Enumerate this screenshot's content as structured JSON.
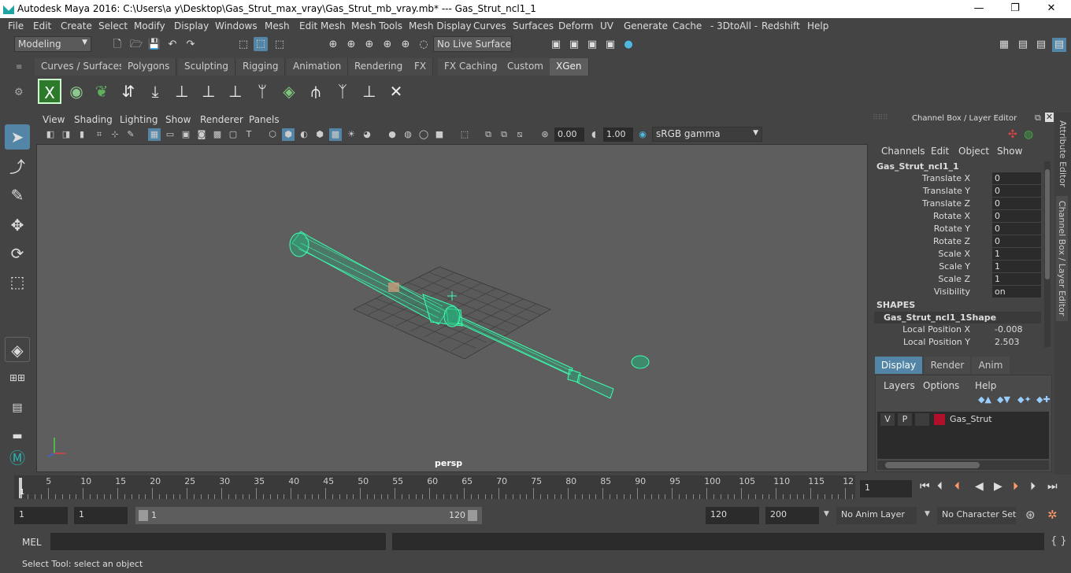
{
  "window": {
    "title": "Autodesk Maya 2016: C:\\Users\\a y\\Desktop\\Gas_Strut_max_vray\\Gas_Strut_mb_vray.mb*   ---   Gas_Strut_ncl1_1",
    "minimize": "—",
    "maximize": "❐",
    "close": "✕"
  },
  "menubar": [
    "File",
    "Edit",
    "Create",
    "Select",
    "Modify",
    "Display",
    "Windows",
    "Mesh",
    "Edit Mesh",
    "Mesh Tools",
    "Mesh Display",
    "Curves",
    "Surfaces",
    "Deform",
    "UV",
    "Generate",
    "Cache",
    "- 3DtoAll -",
    "Redshift",
    "Help"
  ],
  "statusline": {
    "mode": "Modeling",
    "live_surface": "No Live Surface"
  },
  "shelf_tabs": [
    "Curves / Surfaces",
    "Polygons",
    "Sculpting",
    "Rigging",
    "Animation",
    "Rendering",
    "FX",
    "FX Caching",
    "Custom",
    "XGen"
  ],
  "active_shelf_tab": "XGen",
  "panel_menu": [
    "View",
    "Shading",
    "Lighting",
    "Show",
    "Renderer",
    "Panels"
  ],
  "panel_toolbar": {
    "exposure": "0.00",
    "gamma": "1.00",
    "color_space": "sRGB gamma"
  },
  "viewport": {
    "camera_label": "persp"
  },
  "channel_box": {
    "title": "Channel Box / Layer Editor",
    "menus": [
      "Channels",
      "Edit",
      "Object",
      "Show"
    ],
    "object_name": "Gas_Strut_ncl1_1",
    "attributes": [
      {
        "label": "Translate X",
        "value": "0"
      },
      {
        "label": "Translate Y",
        "value": "0"
      },
      {
        "label": "Translate Z",
        "value": "0"
      },
      {
        "label": "Rotate X",
        "value": "0"
      },
      {
        "label": "Rotate Y",
        "value": "0"
      },
      {
        "label": "Rotate Z",
        "value": "0"
      },
      {
        "label": "Scale X",
        "value": "1"
      },
      {
        "label": "Scale Y",
        "value": "1"
      },
      {
        "label": "Scale Z",
        "value": "1"
      },
      {
        "label": "Visibility",
        "value": "on"
      }
    ],
    "shapes_header": "SHAPES",
    "shape_name": "Gas_Strut_ncl1_1Shape",
    "shape_attributes": [
      {
        "label": "Local Position X",
        "value": "-0.008"
      },
      {
        "label": "Local Position Y",
        "value": "2.503"
      }
    ]
  },
  "side_tabs": [
    "Attribute Editor",
    "Channel Box / Layer Editor"
  ],
  "layer_editor": {
    "tabs": [
      "Display",
      "Render",
      "Anim"
    ],
    "active_tab": "Display",
    "menus": [
      "Layers",
      "Options",
      "Help"
    ],
    "layer": {
      "v": "V",
      "p": "P",
      "name": "Gas_Strut",
      "color": "#b0102a"
    }
  },
  "time_slider": {
    "ticks": [
      "5",
      "10",
      "15",
      "20",
      "25",
      "30",
      "35",
      "40",
      "45",
      "50",
      "55",
      "60",
      "65",
      "70",
      "75",
      "80",
      "85",
      "90",
      "95",
      "100",
      "105",
      "110",
      "115",
      "12"
    ],
    "current_frame_marker": "1",
    "current_frame": "1"
  },
  "range_slider": {
    "start_time": "1",
    "playback_start": "1",
    "range_start": "1",
    "range_end": "120",
    "playback_end": "120",
    "end_time": "200",
    "anim_layer": "No Anim Layer",
    "character_set": "No Character Set"
  },
  "command_line": {
    "label": "MEL"
  },
  "help_line": "Select Tool: select an object",
  "colors": {
    "wireframe": "#3dffb0",
    "accent": "#5285a6"
  }
}
